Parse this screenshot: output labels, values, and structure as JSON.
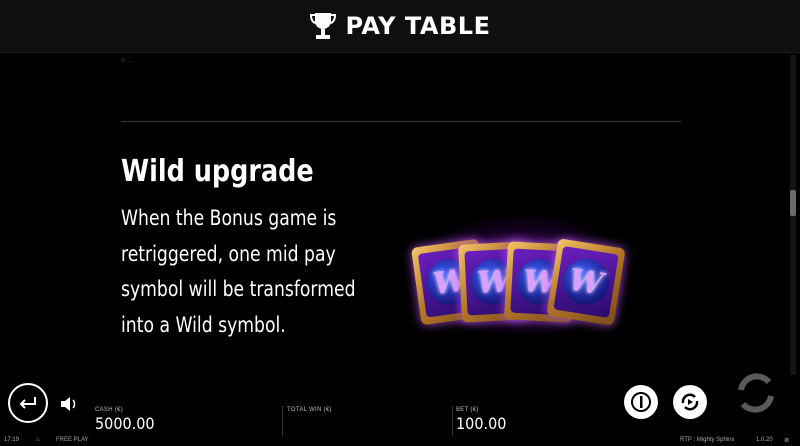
{
  "header": {
    "title": "PAY TABLE",
    "icon": "trophy-icon"
  },
  "note": "Ⓒ ...",
  "section": {
    "heading": "Wild upgrade",
    "description_lines": [
      "When the Bonus game is",
      "retriggered, one mid pay",
      "symbol will be transformed",
      "into a Wild symbol."
    ],
    "card_symbols": [
      "W",
      "W",
      "W",
      "W"
    ]
  },
  "footer": {
    "cash_label": "CASH (€)",
    "cash_value": "5000.00",
    "total_win_label": "TOTAL WIN (€)",
    "bet_label": "BET (€)",
    "bet_value": "100.00"
  },
  "status_bar": {
    "time": "17:19",
    "mode": "FREE PLAY",
    "rtp": "RTP : Mighty Sphinx",
    "version": "1.0.20"
  },
  "colors": {
    "accent_glow": "#b43cff",
    "card_gold": "#f5c46a"
  }
}
